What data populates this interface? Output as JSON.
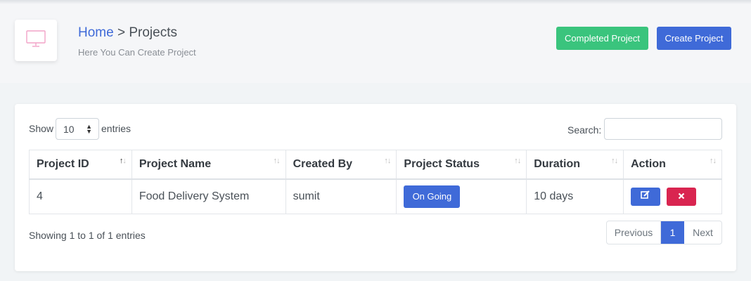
{
  "header": {
    "breadcrumb_home": "Home",
    "breadcrumb_sep": ">",
    "breadcrumb_current": "Projects",
    "subtitle": "Here You Can Create Project",
    "completed_button": "Completed Project",
    "create_button": "Create Project",
    "icon": "monitor-icon"
  },
  "controls": {
    "show_label": "Show",
    "entries_value": "10",
    "entries_label": "entries",
    "search_label": "Search:",
    "search_value": ""
  },
  "table": {
    "columns": [
      "Project ID",
      "Project Name",
      "Created By",
      "Project Status",
      "Duration",
      "Action"
    ],
    "rows": [
      {
        "id": "4",
        "name": "Food Delivery System",
        "created_by": "sumit",
        "status": "On Going",
        "duration": "10 days"
      }
    ]
  },
  "footer": {
    "info": "Showing 1 to 1 of 1 entries",
    "previous": "Previous",
    "current_page": "1",
    "next": "Next"
  },
  "colors": {
    "primary": "#3f6ad8",
    "success": "#3ac47d",
    "danger": "#d92550"
  }
}
